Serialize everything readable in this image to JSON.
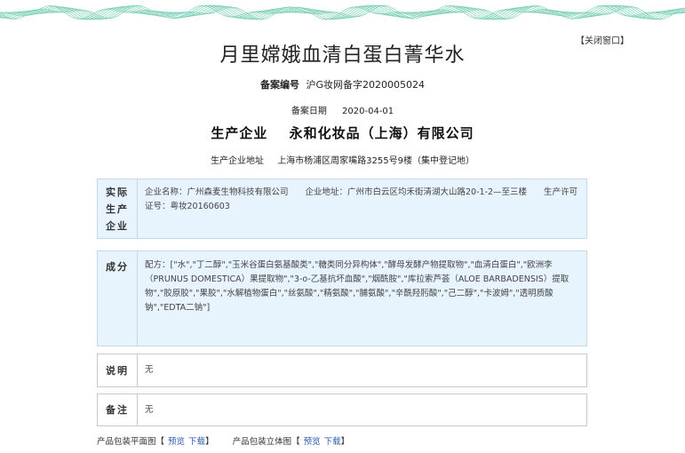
{
  "close_label": "【关闭窗口】",
  "title": "月里嫦娥血清白蛋白菁华水",
  "registration": {
    "label": "备案编号",
    "value": "沪G妆网备字2020005024"
  },
  "filing_date": {
    "label": "备案日期",
    "value": "2020-04-01"
  },
  "company": {
    "label": "生产企业",
    "value": "永和化妆品（上海）有限公司"
  },
  "company_address": {
    "label": "生产企业地址",
    "value": "上海市杨浦区周家嘴路3255号9楼（集中登记地）"
  },
  "producer": {
    "label": "实际生产企业",
    "text": "企业名称：广州森麦生物科技有限公司　　企业地址：广州市白云区均禾街清湖大山路20-1-2—至三楼　　生产许可证号：粤妆20160603"
  },
  "ingredients": {
    "label": "成分",
    "text": "配方：[\"水\",\"丁二醇\",\"玉米谷蛋白氨基酸类\",\"糖类同分异构体\",\"酵母发酵产物提取物\",\"血清白蛋白\",\"欧洲李（PRUNUS DOMESTICA）果提取物\",\"3-o-乙基抗坏血酸\",\"烟酰胺\",\"库拉索芦荟（ALOE BARBADENSIS）提取物\",\"胶原胶\",\"果胶\",\"水解植物蛋白\",\"丝氨酸\",\"精氨酸\",\"脯氨酸\",\"辛酰羟肟酸\",\"己二醇\",\"卡波姆\",\"透明质酸钠\",\"EDTA二钠\"]"
  },
  "notes": {
    "label": "说明",
    "value": "无"
  },
  "remarks": {
    "label": "备注",
    "value": "无"
  },
  "footer": {
    "flat_label": "产品包装平面图",
    "stereo_label": "产品包装立体图",
    "preview_label": "预览",
    "download_label": "下载",
    "bracket_open": "【",
    "bracket_close": "】"
  }
}
